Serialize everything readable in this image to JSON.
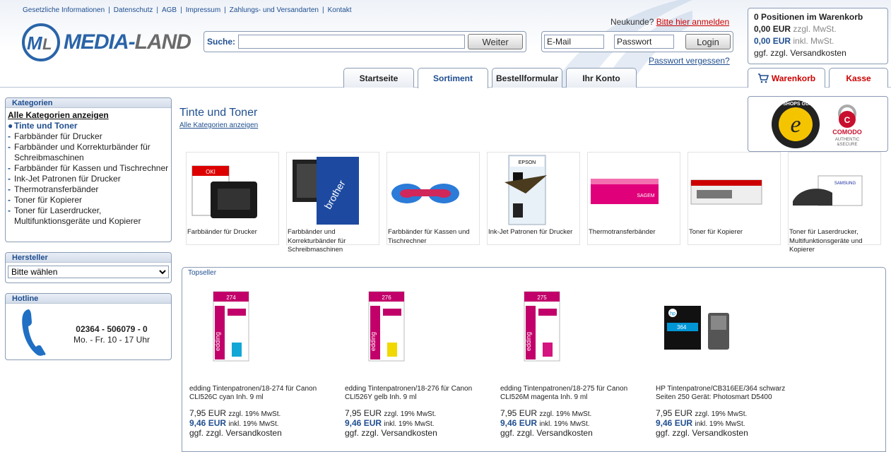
{
  "header": {
    "top_links": [
      "Gesetzliche Informationen",
      "Datenschutz",
      "AGB",
      "Impressum",
      "Zahlungs- und Versandarten",
      "Kontakt"
    ],
    "logo_text_a": "MEDIA-",
    "logo_text_b": "LAND",
    "search": {
      "label": "Suche:",
      "value": "",
      "button": "Weiter"
    },
    "neukunde_text": "Neukunde?",
    "neukunde_link": "Bitte hier anmelden",
    "login": {
      "email_placeholder": "E-Mail",
      "password_placeholder": "Passwort",
      "button": "Login"
    },
    "password_forgot": "Passwort vergessen?",
    "tabs": [
      "Startseite",
      "Sortiment",
      "Bestellformular",
      "Ihr Konto"
    ],
    "active_tab": "Sortiment"
  },
  "cart": {
    "title": "0 Positionen im Warenkorb",
    "net_amount": "0,00 EUR",
    "net_label": "zzgl. MwSt.",
    "gross_amount": "0,00 EUR",
    "gross_label": "inkl. MwSt.",
    "shipping": "ggf. zzgl. Versandkosten",
    "tab_cart": "Warenkorb",
    "tab_checkout": "Kasse"
  },
  "sidebar": {
    "categories": {
      "title": "Kategorien",
      "all_label": "Alle Kategorien anzeigen",
      "items": [
        {
          "label": "Tinte und Toner",
          "active": true
        },
        {
          "label": "Farbbänder für Drucker",
          "active": false
        },
        {
          "label": "Farbbänder und Korrekturbänder für Schreibmaschinen",
          "active": false
        },
        {
          "label": "Farbbänder für Kassen und Tischrechner",
          "active": false
        },
        {
          "label": "Ink-Jet Patronen für Drucker",
          "active": false
        },
        {
          "label": "Thermotransferbänder",
          "active": false
        },
        {
          "label": "Toner für Kopierer",
          "active": false
        },
        {
          "label": "Toner für Laserdrucker, Multifunktionsgeräte und Kopierer",
          "active": false
        }
      ]
    },
    "manufacturer": {
      "title": "Hersteller",
      "selected": "Bitte wählen"
    },
    "hotline": {
      "title": "Hotline",
      "number": "02364 - 506079 - 0",
      "hours": "Mo. - Fr. 10 - 17 Uhr"
    }
  },
  "main": {
    "title": "Tinte und Toner",
    "all_categories_link": "Alle Kategorien anzeigen",
    "trust": {
      "trusted_shops": "TRUSTED SHOPS GUARANTEE",
      "comodo_a": "COMODO",
      "comodo_b": "AUTHENTIC",
      "comodo_c": "&SECURE"
    },
    "category_tiles": [
      "Farbbänder für Drucker",
      "Farbbänder und Korrekturbänder für Schreibmaschinen",
      "Farbbänder für Kassen und Tischrechner",
      "Ink-Jet Patronen für Drucker",
      "Thermotransferbänder",
      "Toner für Kopierer",
      "Toner für Laserdrucker, Multifunktionsgeräte und Kopierer"
    ],
    "topseller": {
      "title": "Topseller",
      "products": [
        {
          "name": "edding Tintenpatronen/18-274 für Canon CLI526C cyan Inh. 9 ml",
          "net": "7,95 EUR",
          "net_label": "zzgl. 19% MwSt.",
          "gross": "9,46 EUR",
          "gross_label": "inkl. 19% MwSt.",
          "shipping": "ggf. zzgl. Versandkosten",
          "badge": "274",
          "color": "#12a7d6"
        },
        {
          "name": "edding Tintenpatronen/18-276 für Canon CLI526Y gelb Inh. 9 ml",
          "net": "7,95 EUR",
          "net_label": "zzgl. 19% MwSt.",
          "gross": "9,46 EUR",
          "gross_label": "inkl. 19% MwSt.",
          "shipping": "ggf. zzgl. Versandkosten",
          "badge": "276",
          "color": "#f0d800"
        },
        {
          "name": "edding Tintenpatronen/18-275 für Canon CLI526M magenta Inh. 9 ml",
          "net": "7,95 EUR",
          "net_label": "zzgl. 19% MwSt.",
          "gross": "9,46 EUR",
          "gross_label": "inkl. 19% MwSt.",
          "shipping": "ggf. zzgl. Versandkosten",
          "badge": "275",
          "color": "#d4147f"
        },
        {
          "name": "HP Tintenpatrone/CB316EE/364 schwarz Seiten 250 Gerät: Photosmart D5400",
          "net": "7,95 EUR",
          "net_label": "zzgl. 19% MwSt.",
          "gross": "9,46 EUR",
          "gross_label": "inkl. 19% MwSt.",
          "shipping": "ggf. zzgl. Versandkosten",
          "badge": "364",
          "color": "#222222"
        }
      ]
    }
  },
  "colors": {
    "brand_blue": "#1f4e8f",
    "link_red": "#cc0000",
    "border": "#8a9bb4"
  }
}
